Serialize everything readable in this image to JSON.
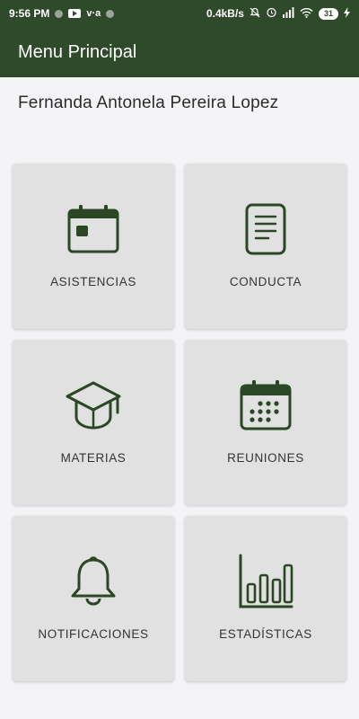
{
  "status_bar": {
    "time": "9:56 PM",
    "network_speed": "0.4kB/s",
    "battery_level": "31",
    "icons": [
      "notification-dot-icon",
      "youtube-icon",
      "vpn-icon",
      "notification-dot-icon",
      "silent-bell-icon",
      "alarm-icon",
      "signal-icon",
      "wifi-icon",
      "battery-icon",
      "charging-icon"
    ]
  },
  "app_bar": {
    "title": "Menu Principal"
  },
  "user": {
    "name": "Fernanda Antonela Pereira Lopez"
  },
  "menu": {
    "items": [
      {
        "label": "ASISTENCIAS",
        "icon": "calendar-card-icon"
      },
      {
        "label": "CONDUCTA",
        "icon": "document-icon"
      },
      {
        "label": "MATERIAS",
        "icon": "graduation-cap-icon"
      },
      {
        "label": "REUNIONES",
        "icon": "calendar-dots-icon"
      },
      {
        "label": "NOTIFICACIONES",
        "icon": "bell-icon"
      },
      {
        "label": "ESTADÍSTICAS",
        "icon": "bar-chart-icon"
      }
    ]
  },
  "colors": {
    "primary": "#2f4a2a",
    "icon": "#2b4726",
    "card_background": "#e1e1e1",
    "page_background": "#f4f4f7"
  }
}
